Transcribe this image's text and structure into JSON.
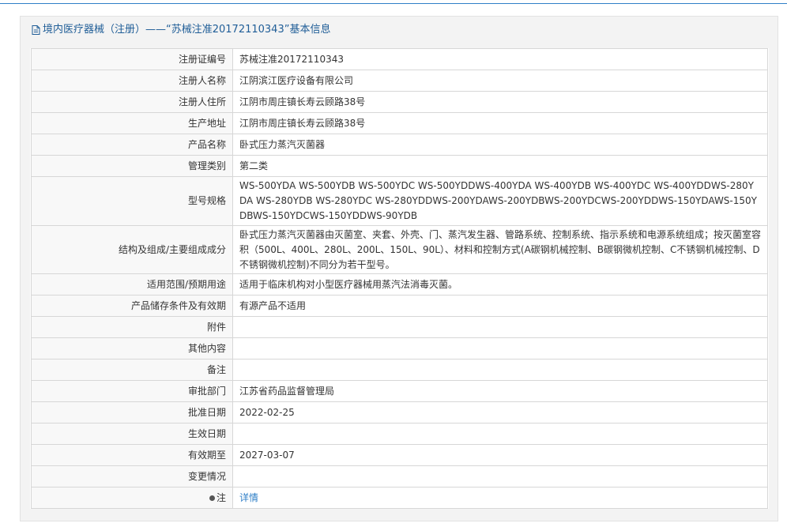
{
  "title": {
    "icon": "document-icon",
    "text": "境内医疗器械（注册）——“苏械注准20172110343”基本信息"
  },
  "rows": [
    {
      "label": "注册证编号",
      "value": "苏械注准20172110343"
    },
    {
      "label": "注册人名称",
      "value": "江阴滨江医疗设备有限公司"
    },
    {
      "label": "注册人住所",
      "value": "江阴市周庄镇长寿云顾路38号"
    },
    {
      "label": "生产地址",
      "value": "江阴市周庄镇长寿云顾路38号"
    },
    {
      "label": "产品名称",
      "value": "卧式压力蒸汽灭菌器"
    },
    {
      "label": "管理类别",
      "value": "第二类"
    },
    {
      "label": "型号规格",
      "value": "WS-500YDA WS-500YDB WS-500YDC WS-500YDDWS-400YDA WS-400YDB WS-400YDC WS-400YDDWS-280YDA WS-280YDB WS-280YDC WS-280YDDWS-200YDAWS-200YDBWS-200YDCWS-200YDDWS-150YDAWS-150YDBWS-150YDCWS-150YDDWS-90YDB"
    },
    {
      "label": "结构及组成/主要组成成分",
      "value": "卧式压力蒸汽灭菌器由灭菌室、夹套、外壳、门、蒸汽发生器、管路系统、控制系统、指示系统和电源系统组成；按灭菌室容积（500L、400L、280L、200L、150L、90L）、材料和控制方式(A碳钢机械控制、B碳钢微机控制、C不锈钢机械控制、D不锈钢微机控制)不同分为若干型号。"
    },
    {
      "label": "适用范围/预期用途",
      "value": "适用于临床机构对小型医疗器械用蒸汽法消毒灭菌。"
    },
    {
      "label": "产品储存条件及有效期",
      "value": "有源产品不适用"
    },
    {
      "label": "附件",
      "value": ""
    },
    {
      "label": "其他内容",
      "value": ""
    },
    {
      "label": "备注",
      "value": ""
    },
    {
      "label": "审批部门",
      "value": "江苏省药品监督管理局"
    },
    {
      "label": "批准日期",
      "value": "2022-02-25"
    },
    {
      "label": "生效日期",
      "value": ""
    },
    {
      "label": "有效期至",
      "value": "2027-03-07"
    },
    {
      "label": "变更情况",
      "value": ""
    },
    {
      "label": "注",
      "value": "详情",
      "icon": "bullet-icon"
    }
  ]
}
